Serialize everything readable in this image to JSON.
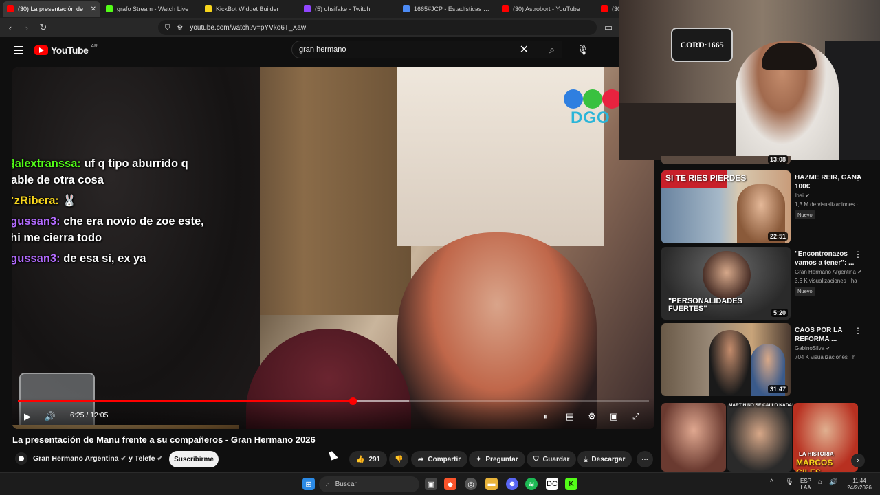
{
  "browser": {
    "tabs": [
      {
        "label": "(30) La presentación de",
        "favicon_color": "#ff0000",
        "active": true
      },
      {
        "label": "grafo Stream - Watch Live",
        "favicon_color": "#53fc18",
        "active": false
      },
      {
        "label": "KickBot Widget Builder",
        "favicon_color": "#f7d51d",
        "active": false
      },
      {
        "label": "(5) ohsifake - Twitch",
        "favicon_color": "#9146ff",
        "active": false
      },
      {
        "label": "1665#JCP - Estadísticas del im",
        "favicon_color": "#4c8bf5",
        "active": false
      },
      {
        "label": "(30) Astrobort - YouTube",
        "favicon_color": "#ff0000",
        "active": false
      },
      {
        "label": "(30) M",
        "favicon_color": "#ff0000",
        "active": false
      }
    ],
    "tab_close": "✕",
    "url": "youtube.com/watch?v=pYVko6T_Xaw"
  },
  "youtube": {
    "logo": "YouTube",
    "region": "AR",
    "search_value": "gran hermano"
  },
  "overlay_chat": [
    {
      "user": "alextranssa:",
      "user_color": "#53fc18",
      "badge": "▦",
      "text": "uf q tipo aburrido q hable de otra cosa"
    },
    {
      "user": "zRibera:",
      "user_color": "#f7d51d",
      "badge": "♛",
      "text": "🐰"
    },
    {
      "user": "agussan3:",
      "user_color": "#b36bff",
      "badge": "",
      "text": "che era novio de zoe este, ahi me cierra todo"
    },
    {
      "user": "agussan3:",
      "user_color": "#b36bff",
      "badge": "",
      "text": "de esa si, ex ya"
    }
  ],
  "player": {
    "time": "6:25 / 12:05",
    "progress": 0.53,
    "buffered": 0.62,
    "watermark": "DGO"
  },
  "video": {
    "title": "La presentación de Manu frente a su compañeros - Gran Hermano 2026",
    "channel": "Gran Hermano Argentina",
    "channel_suffix": "y Telefe",
    "subscribe_label": "Suscribirme",
    "likes": "291",
    "share_label": "Compartir",
    "ask_label": "Preguntar",
    "save_label": "Guardar",
    "download_label": "Descargar"
  },
  "webcam": {
    "sign_text": "CORD·1665"
  },
  "sidebar": {
    "top_duration": "13:08",
    "items": [
      {
        "title": "HAZME REIR, GANA 100€",
        "channel": "Ibai",
        "views": "1,3 M de visualizaciones · ",
        "badge": "Nuevo",
        "duration": "22:51",
        "thumb_text": "SI TE RIES PIERDES"
      },
      {
        "title": "\"Encontronazos vamos a tener\": ...",
        "channel": "Gran Hermano Argentina",
        "views": "3,6 K visualizaciones · ha",
        "badge": "Nuevo",
        "duration": "5:20",
        "thumb_text": "\"PERSONALIDADES FUERTES\""
      },
      {
        "title": "CAOS POR LA REFORMA ...",
        "channel": "GabinoSilva",
        "views": "704 K visualizaciones · h",
        "badge": "",
        "duration": "31:47",
        "thumb_text": ""
      },
      {
        "title": "",
        "channel": "",
        "views": "",
        "badge": "",
        "duration": "",
        "thumb_text": "MARTIN NO SE CALLO NADA!",
        "thumb_text2": "LA HISTORIA",
        "thumb_text3": "MARCOS GILES"
      }
    ]
  },
  "taskbar": {
    "search_placeholder": "Buscar",
    "lang_top": "ESP",
    "lang_bottom": "LAA",
    "time": "11:44",
    "date": "24/2/2026"
  }
}
